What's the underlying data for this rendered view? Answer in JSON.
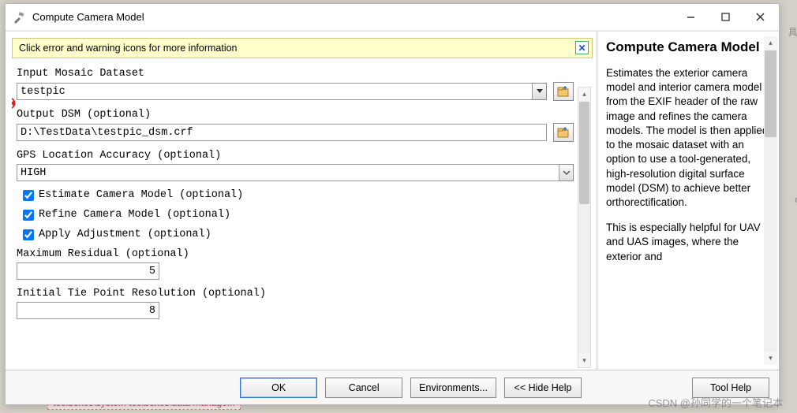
{
  "window": {
    "title": "Compute Camera Model"
  },
  "info_bar": "Click error and warning icons for more information",
  "fields": {
    "mosaic_label": "Input Mosaic Dataset",
    "mosaic_value": "testpic",
    "dsm_label": "Output DSM (optional)",
    "dsm_value": "D:\\TestData\\testpic_dsm.crf",
    "gps_label": "GPS Location Accuracy (optional)",
    "gps_value": "HIGH",
    "estimate_label": "Estimate Camera Model (optional)",
    "refine_label": "Refine Camera Model (optional)",
    "adjust_label": "Apply Adjustment (optional)",
    "maxres_label": "Maximum Residual (optional)",
    "maxres_value": "5",
    "tie_label": "Initial Tie Point Resolution (optional)",
    "tie_value": "8"
  },
  "help": {
    "title": "Compute Camera Model",
    "p1": "Estimates the exterior camera model and interior camera model from the EXIF header of the raw image and refines the camera models. The model is then applied to the mosaic dataset with an option to use a tool-generated, high-resolution digital surface model (DSM) to achieve better orthorectification.",
    "p2": "This is especially helpful for UAV and UAS images, where the exterior and"
  },
  "buttons": {
    "ok": "OK",
    "cancel": "Cancel",
    "env": "Environments...",
    "hide": "<< Hide Help",
    "toolhelp": "Tool Help"
  },
  "watermark": "CSDN @孙同学的一个笔记本",
  "bg_strip": "toolboxes\\system toolboxes\\data manage..."
}
